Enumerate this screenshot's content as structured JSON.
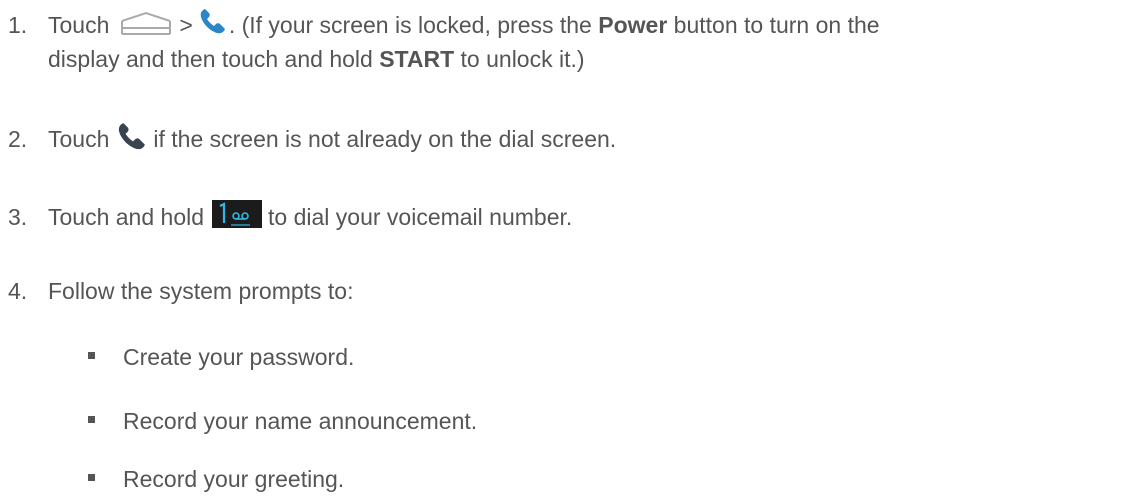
{
  "steps": [
    {
      "number": "1.",
      "pre": "Touch",
      "sep": ">",
      "text_a": ". (If your screen is locked, press the ",
      "bold_a": "Power",
      "text_b": " button to turn on the",
      "line2_a": "display and then touch and hold ",
      "bold_b": "START",
      "line2_b": " to unlock it.)",
      "icons": [
        "home-icon",
        "phone-icon"
      ]
    },
    {
      "number": "2.",
      "pre": "Touch",
      "post": "if the screen is not already on the dial screen.",
      "icons": [
        "phone-icon"
      ]
    },
    {
      "number": "3.",
      "pre": "Touch and hold",
      "post": "to dial your voicemail number.",
      "icons": [
        "voicemail-key-icon"
      ]
    },
    {
      "number": "4.",
      "text": "Follow the system prompts to:"
    }
  ],
  "bullets": [
    "Create your password.",
    "Record your name announcement.",
    "Record your greeting."
  ],
  "colors": {
    "text": "#555555",
    "phone_blue": "#2a86c8",
    "key_bg": "#1b1b1b",
    "key_accent": "#33b5e5"
  }
}
